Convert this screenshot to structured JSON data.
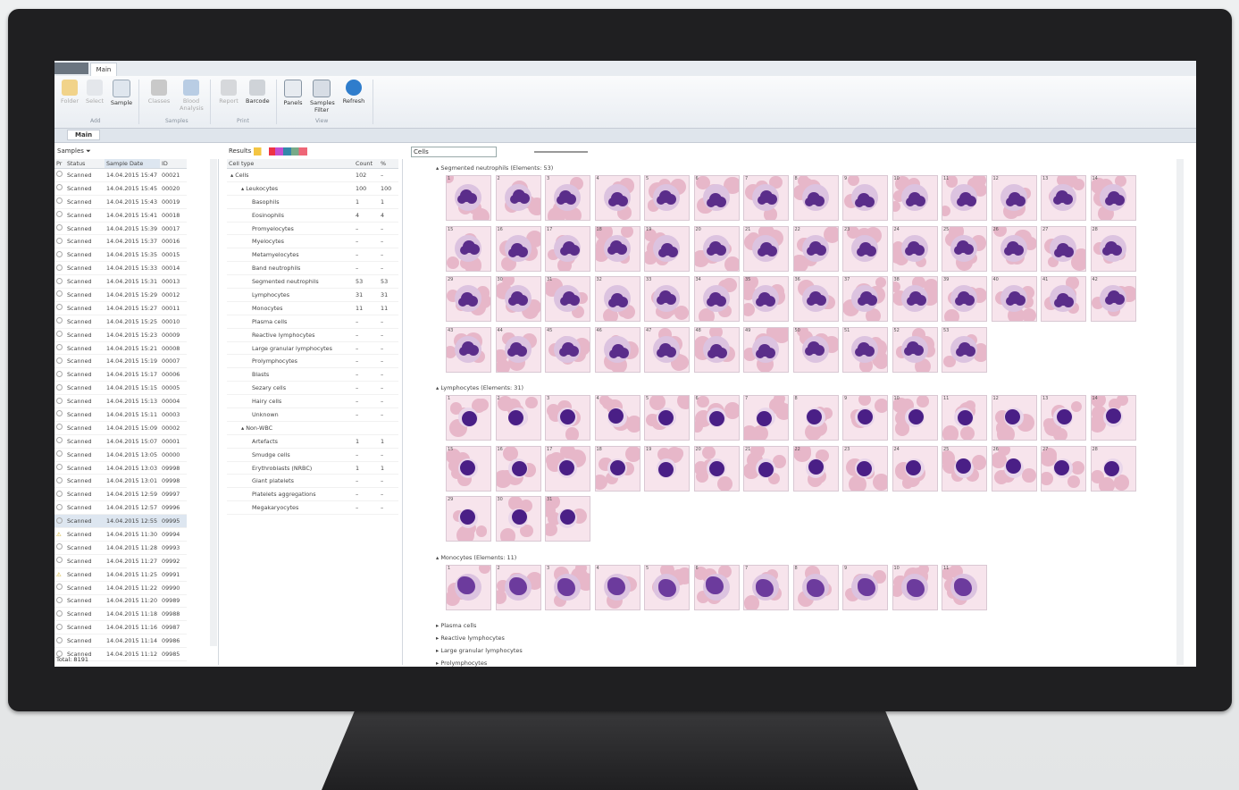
{
  "ribbon": {
    "tabs": [
      "Main"
    ],
    "groups": [
      {
        "label": "Add",
        "buttons": [
          "Folder",
          "Select",
          "Sample"
        ]
      },
      {
        "label": "Samples",
        "buttons": [
          "Classes",
          "Blood Analysis"
        ]
      },
      {
        "label": "Print",
        "buttons": [
          "Report",
          "Barcode"
        ]
      },
      {
        "label": "View",
        "buttons": [
          "Panels",
          "Samples Filter",
          "Refresh"
        ]
      }
    ]
  },
  "doc_tab": "Main",
  "samples": {
    "label": "Samples",
    "columns": [
      "Pr",
      "Status",
      "Sample Date",
      "ID"
    ],
    "rows": [
      [
        "",
        "Scanned",
        "14.04.2015 15:47",
        "00021"
      ],
      [
        "",
        "Scanned",
        "14.04.2015 15:45",
        "00020"
      ],
      [
        "",
        "Scanned",
        "14.04.2015 15:43",
        "00019"
      ],
      [
        "",
        "Scanned",
        "14.04.2015 15:41",
        "00018"
      ],
      [
        "",
        "Scanned",
        "14.04.2015 15:39",
        "00017"
      ],
      [
        "",
        "Scanned",
        "14.04.2015 15:37",
        "00016"
      ],
      [
        "",
        "Scanned",
        "14.04.2015 15:35",
        "00015"
      ],
      [
        "",
        "Scanned",
        "14.04.2015 15:33",
        "00014"
      ],
      [
        "",
        "Scanned",
        "14.04.2015 15:31",
        "00013"
      ],
      [
        "",
        "Scanned",
        "14.04.2015 15:29",
        "00012"
      ],
      [
        "",
        "Scanned",
        "14.04.2015 15:27",
        "00011"
      ],
      [
        "",
        "Scanned",
        "14.04.2015 15:25",
        "00010"
      ],
      [
        "",
        "Scanned",
        "14.04.2015 15:23",
        "00009"
      ],
      [
        "",
        "Scanned",
        "14.04.2015 15:21",
        "00008"
      ],
      [
        "",
        "Scanned",
        "14.04.2015 15:19",
        "00007"
      ],
      [
        "",
        "Scanned",
        "14.04.2015 15:17",
        "00006"
      ],
      [
        "",
        "Scanned",
        "14.04.2015 15:15",
        "00005"
      ],
      [
        "",
        "Scanned",
        "14.04.2015 15:13",
        "00004"
      ],
      [
        "",
        "Scanned",
        "14.04.2015 15:11",
        "00003"
      ],
      [
        "",
        "Scanned",
        "14.04.2015 15:09",
        "00002"
      ],
      [
        "",
        "Scanned",
        "14.04.2015 15:07",
        "00001"
      ],
      [
        "",
        "Scanned",
        "14.04.2015 13:05",
        "00000"
      ],
      [
        "",
        "Scanned",
        "14.04.2015 13:03",
        "09998"
      ],
      [
        "",
        "Scanned",
        "14.04.2015 13:01",
        "09998"
      ],
      [
        "",
        "Scanned",
        "14.04.2015 12:59",
        "09997"
      ],
      [
        "",
        "Scanned",
        "14.04.2015 12:57",
        "09996"
      ],
      [
        "",
        "Scanned",
        "14.04.2015 12:55",
        "09995"
      ],
      [
        "warn",
        "Scanned",
        "14.04.2015 11:30",
        "09994"
      ],
      [
        "",
        "Scanned",
        "14.04.2015 11:28",
        "09993"
      ],
      [
        "",
        "Scanned",
        "14.04.2015 11:27",
        "09992"
      ],
      [
        "warn",
        "Scanned",
        "14.04.2015 11:25",
        "09991"
      ],
      [
        "",
        "Scanned",
        "14.04.2015 11:22",
        "09990"
      ],
      [
        "",
        "Scanned",
        "14.04.2015 11:20",
        "09989"
      ],
      [
        "",
        "Scanned",
        "14.04.2015 11:18",
        "09988"
      ],
      [
        "",
        "Scanned",
        "14.04.2015 11:16",
        "09987"
      ],
      [
        "",
        "Scanned",
        "14.04.2015 11:14",
        "09986"
      ],
      [
        "",
        "Scanned",
        "14.04.2015 11:12",
        "09985"
      ]
    ],
    "selected_index": 26,
    "total": "Total: 8191"
  },
  "results": {
    "label": "Results",
    "columns": [
      "Cell type",
      "Count",
      "%"
    ],
    "rows": [
      {
        "indent": 0,
        "name": "▴ Cells",
        "count": "102",
        "pct": "–"
      },
      {
        "indent": 1,
        "name": "▴ Leukocytes",
        "count": "100",
        "pct": "100"
      },
      {
        "indent": 2,
        "name": "Basophils",
        "count": "1",
        "pct": "1"
      },
      {
        "indent": 2,
        "name": "Eosinophils",
        "count": "4",
        "pct": "4"
      },
      {
        "indent": 2,
        "name": "Promyelocytes",
        "count": "–",
        "pct": "–"
      },
      {
        "indent": 2,
        "name": "Myelocytes",
        "count": "–",
        "pct": "–"
      },
      {
        "indent": 2,
        "name": "Metamyelocytes",
        "count": "–",
        "pct": "–"
      },
      {
        "indent": 2,
        "name": "Band neutrophils",
        "count": "–",
        "pct": "–"
      },
      {
        "indent": 2,
        "name": "Segmented neutrophils",
        "count": "53",
        "pct": "53"
      },
      {
        "indent": 2,
        "name": "Lymphocytes",
        "count": "31",
        "pct": "31"
      },
      {
        "indent": 2,
        "name": "Monocytes",
        "count": "11",
        "pct": "11"
      },
      {
        "indent": 2,
        "name": "Plasma cells",
        "count": "–",
        "pct": "–"
      },
      {
        "indent": 2,
        "name": "Reactive lymphocytes",
        "count": "–",
        "pct": "–"
      },
      {
        "indent": 2,
        "name": "Large granular lymphocytes",
        "count": "–",
        "pct": "–"
      },
      {
        "indent": 2,
        "name": "Prolymphocytes",
        "count": "–",
        "pct": "–"
      },
      {
        "indent": 2,
        "name": "Blasts",
        "count": "–",
        "pct": "–"
      },
      {
        "indent": 2,
        "name": "Sezary cells",
        "count": "–",
        "pct": "–"
      },
      {
        "indent": 2,
        "name": "Hairy cells",
        "count": "–",
        "pct": "–"
      },
      {
        "indent": 2,
        "name": "Unknown",
        "count": "–",
        "pct": "–"
      },
      {
        "indent": 1,
        "name": "▴ Non-WBC",
        "count": "",
        "pct": ""
      },
      {
        "indent": 2,
        "name": "Artefacts",
        "count": "1",
        "pct": "1"
      },
      {
        "indent": 2,
        "name": "Smudge cells",
        "count": "–",
        "pct": "–"
      },
      {
        "indent": 2,
        "name": "Erythroblasts (NRBC)",
        "count": "1",
        "pct": "1"
      },
      {
        "indent": 2,
        "name": "Giant platelets",
        "count": "–",
        "pct": "–"
      },
      {
        "indent": 2,
        "name": "Platelets aggregations",
        "count": "–",
        "pct": "–"
      },
      {
        "indent": 2,
        "name": "Megakaryocytes",
        "count": "–",
        "pct": "–"
      }
    ]
  },
  "gallery": {
    "dropdown_value": "Cells",
    "sections": [
      {
        "title": "▴ Segmented neutrophils (Elements: 53)",
        "count": 53,
        "nucleus_color": "#5a2d8a",
        "type": "seg"
      },
      {
        "title": "▴ Lymphocytes (Elements: 31)",
        "count": 31,
        "nucleus_color": "#4a1f86",
        "type": "lym"
      },
      {
        "title": "▴ Monocytes (Elements: 11)",
        "count": 11,
        "nucleus_color": "#6c3b9d",
        "type": "mon"
      }
    ],
    "collapsed": [
      "▸ Plasma cells",
      "▸ Reactive lymphocytes",
      "▸ Large granular lymphocytes",
      "▸ Prolymphocytes"
    ]
  }
}
